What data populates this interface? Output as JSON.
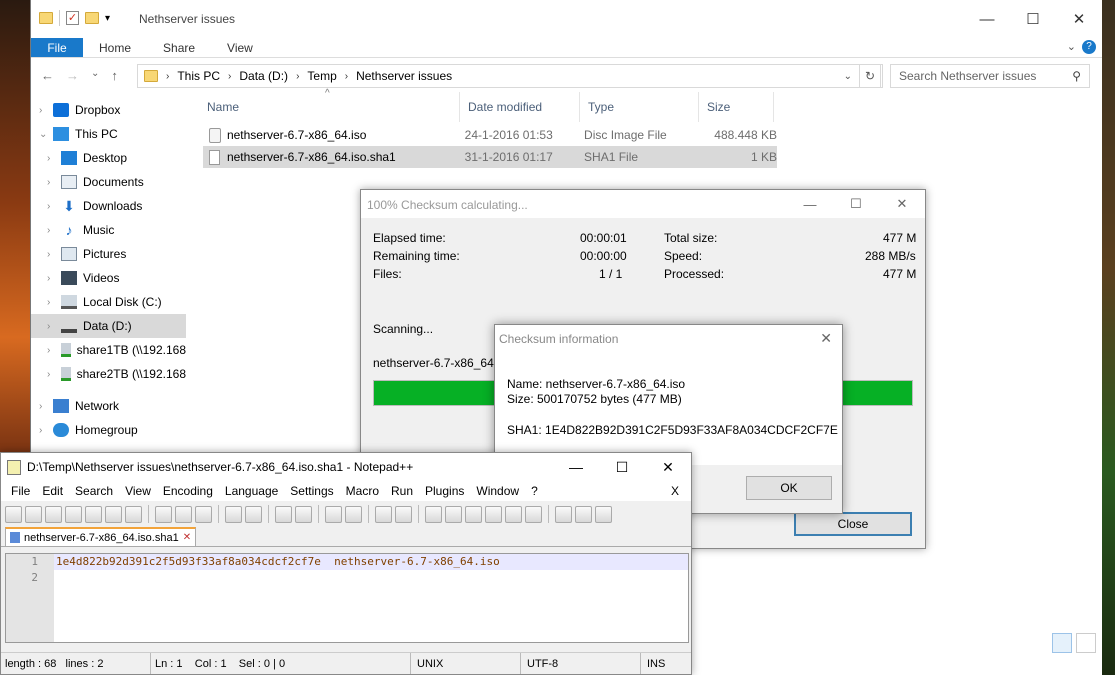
{
  "explorer": {
    "title": "Nethserver issues",
    "window_controls": {
      "minimize": "—",
      "maximize": "☐",
      "close": "✕"
    },
    "ribbon": {
      "file": "File",
      "tabs": [
        "Home",
        "Share",
        "View"
      ],
      "expand": "⌄",
      "help": "?"
    },
    "nav_buttons": {
      "back": "←",
      "forward": "→",
      "recent": "⌄",
      "up": "↑"
    },
    "breadcrumb": [
      "This PC",
      "Data (D:)",
      "Temp",
      "Nethserver issues"
    ],
    "address_dropdown": "⌄",
    "refresh_icon": "↻",
    "search_placeholder": "Search Nethserver issues",
    "search_icon": "⚲",
    "nav_items": [
      {
        "label": "Dropbox"
      },
      {
        "label": "This PC"
      },
      {
        "label": "Desktop"
      },
      {
        "label": "Documents"
      },
      {
        "label": "Downloads"
      },
      {
        "label": "Music"
      },
      {
        "label": "Pictures"
      },
      {
        "label": "Videos"
      },
      {
        "label": "Local Disk (C:)"
      },
      {
        "label": "Data (D:)"
      },
      {
        "label": "share1TB (\\\\192.168"
      },
      {
        "label": "share2TB (\\\\192.168"
      },
      {
        "label": "Network"
      },
      {
        "label": "Homegroup"
      }
    ],
    "columns": [
      "Name",
      "Date modified",
      "Type",
      "Size"
    ],
    "sort_caret": "^",
    "files": [
      {
        "name": "nethserver-6.7-x86_64.iso",
        "date": "24-1-2016 01:53",
        "type": "Disc Image File",
        "size": "488.448 KB"
      },
      {
        "name": "nethserver-6.7-x86_64.iso.sha1",
        "date": "31-1-2016 01:17",
        "type": "SHA1 File",
        "size": "1 KB"
      }
    ]
  },
  "progress_dialog": {
    "title": "100% Checksum calculating...",
    "controls": {
      "minimize": "—",
      "maximize": "☐",
      "close": "✕"
    },
    "elapsed_label": "Elapsed time:",
    "elapsed": "00:00:01",
    "remaining_label": "Remaining time:",
    "remaining": "00:00:00",
    "files_label": "Files:",
    "files": "1 / 1",
    "total_label": "Total size:",
    "total": "477 M",
    "speed_label": "Speed:",
    "speed": "288 MB/s",
    "processed_label": "Processed:",
    "processed": "477 M",
    "status": "Scanning...",
    "current_file": "nethserver-6.7-x86_64.iso",
    "progress_fraction": 1.0,
    "close_label": "Close"
  },
  "info_dialog": {
    "title": "Checksum information",
    "close_icon": "✕",
    "name_line": "Name: nethserver-6.7-x86_64.iso",
    "size_line": "Size: 500170752 bytes (477 MB)",
    "sha_line": "SHA1: 1E4D822B92D391C2F5D93F33AF8A034CDCF2CF7E",
    "ok_label": "OK"
  },
  "notepad": {
    "title": "D:\\Temp\\Nethserver issues\\nethserver-6.7-x86_64.iso.sha1 - Notepad++",
    "controls": {
      "minimize": "—",
      "maximize": "☐",
      "close": "✕"
    },
    "menu": [
      "File",
      "Edit",
      "Search",
      "View",
      "Encoding",
      "Language",
      "Settings",
      "Macro",
      "Run",
      "Plugins",
      "Window",
      "?"
    ],
    "menu_close": "X",
    "tab_label": "nethserver-6.7-x86_64.iso.sha1",
    "tab_close": "✕",
    "line_numbers": [
      "1",
      "2"
    ],
    "line1_hash": "1e4d822b92d391c2f5d93f33af8a034cdcf2cf7e",
    "line1_file": "  nethserver-6.7-x86_64.iso",
    "status": {
      "length": "length : 68",
      "lines": "lines : 2",
      "ln": "Ln : 1",
      "col": "Col : 1",
      "sel": "Sel : 0 | 0",
      "eol": "UNIX",
      "encoding": "UTF-8",
      "mode": "INS"
    }
  },
  "colors": {
    "file_tab": "#1979ca",
    "progress": "#06b025",
    "selection": "#d9d9d9"
  }
}
